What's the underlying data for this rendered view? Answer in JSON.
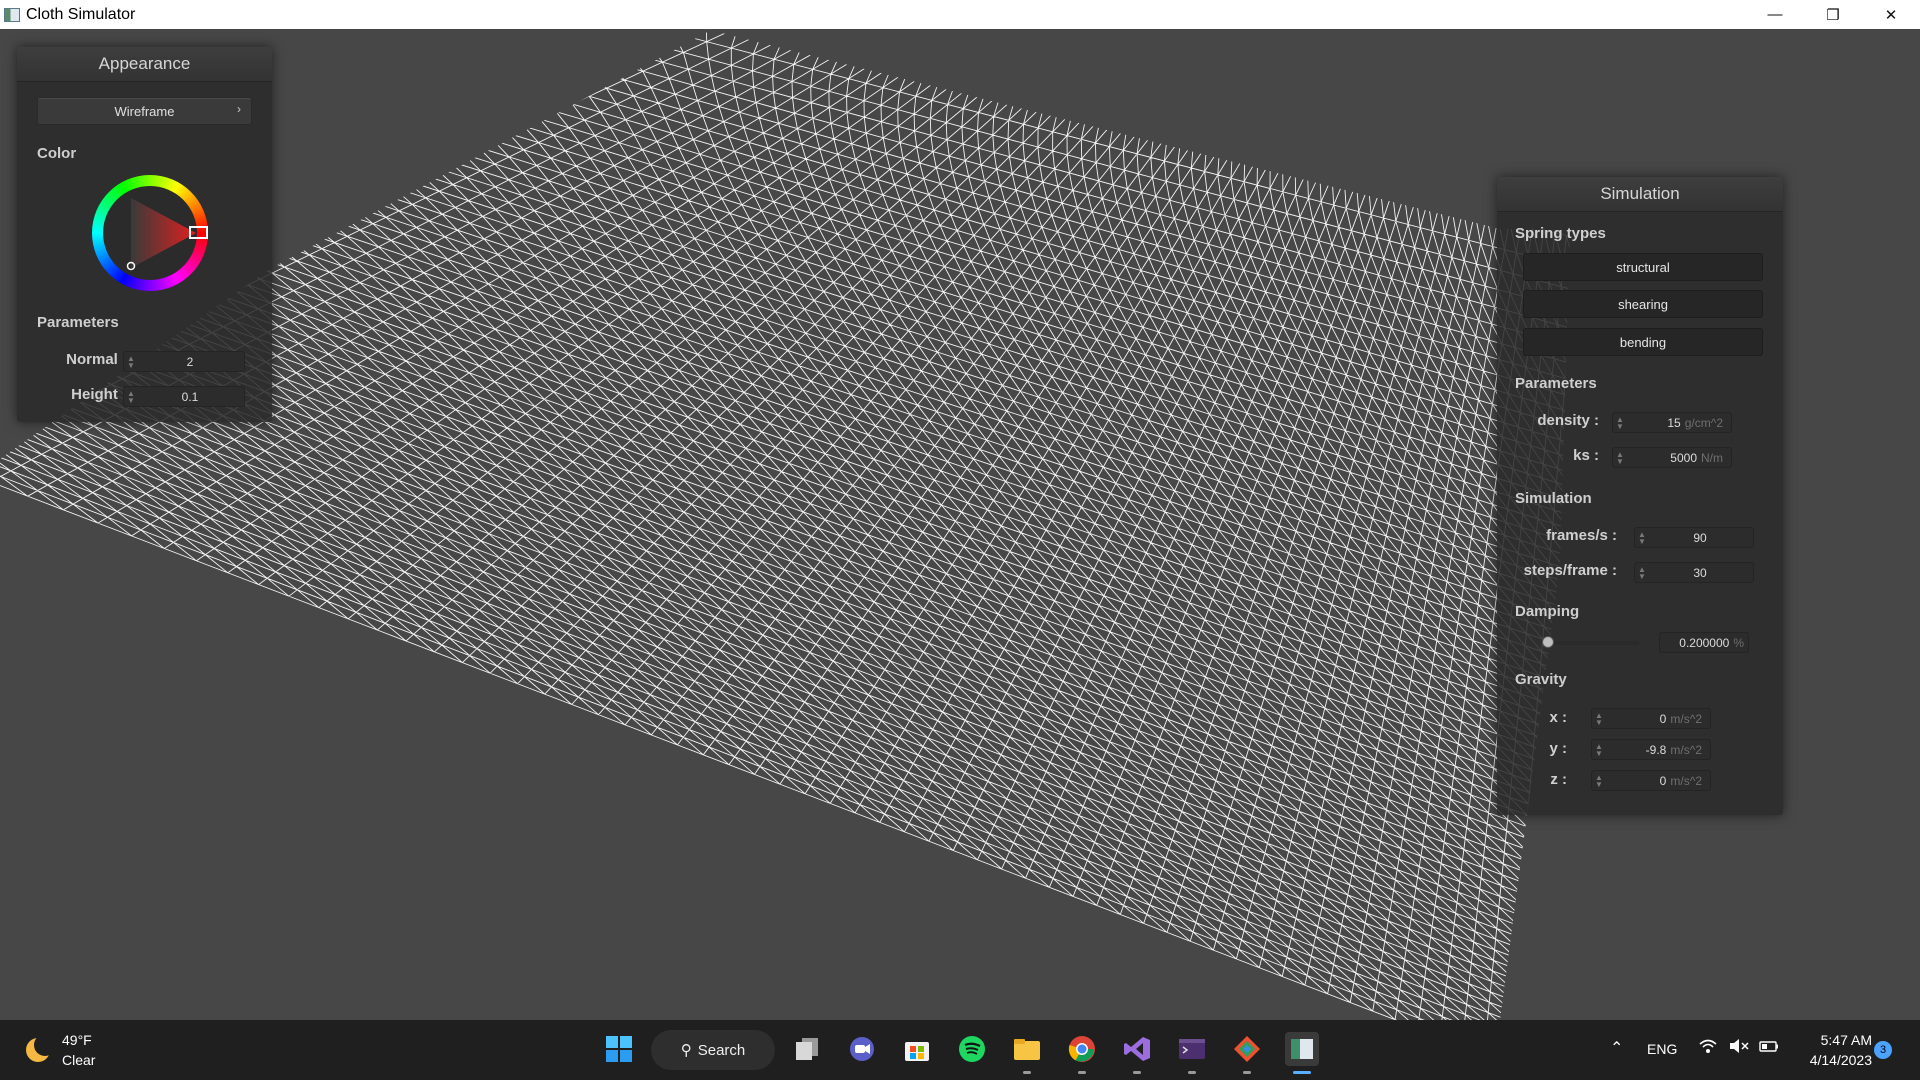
{
  "window": {
    "title": "Cloth Simulator"
  },
  "appearance": {
    "header": "Appearance",
    "mode_selected": "Wireframe",
    "color_label": "Color",
    "params_label": "Parameters",
    "normal_label": "Normal :",
    "normal_value": "2",
    "height_label": "Height :",
    "height_value": "0.1"
  },
  "simulation_panel": {
    "header": "Simulation",
    "spring_types_label": "Spring types",
    "spring_buttons": [
      "structural",
      "shearing",
      "bending"
    ],
    "params_label": "Parameters",
    "density_label": "density :",
    "density_value": "15",
    "density_unit": "g/cm^2",
    "ks_label": "ks :",
    "ks_value": "5000",
    "ks_unit": "N/m",
    "simulation_label": "Simulation",
    "fps_label": "frames/s :",
    "fps_value": "90",
    "steps_label": "steps/frame :",
    "steps_value": "30",
    "damping_label": "Damping",
    "damping_value": "0.200000",
    "damping_unit": "%",
    "damping_level": 0.002,
    "gravity_label": "Gravity",
    "gx_label": "x :",
    "gx_value": "0",
    "gy_label": "y :",
    "gy_value": "-9.8",
    "gz_label": "z :",
    "gz_value": "0",
    "gravity_unit": "m/s^2"
  },
  "taskbar": {
    "temperature": "49°F",
    "condition": "Clear",
    "search_label": "Search",
    "language": "ENG",
    "time": "5:47 AM",
    "date": "4/14/2023",
    "notification_count": "3",
    "apps": [
      "windows-start-icon",
      "task-view-icon",
      "chat-icon",
      "store-icon",
      "spotify-icon",
      "file-explorer-icon",
      "chrome-icon",
      "visual-studio-icon",
      "terminal-icon",
      "git-icon",
      "cloth-simulator-icon"
    ]
  },
  "colors": {
    "background": "#474747",
    "panel": "#2b2b2b",
    "wireframe": "#ffffff",
    "picked_color": "#e02020",
    "accent": "#58b0ff"
  }
}
